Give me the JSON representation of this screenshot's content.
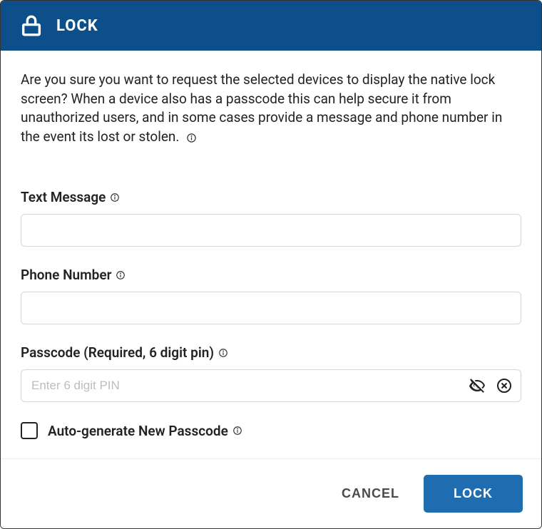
{
  "header": {
    "title": "LOCK"
  },
  "description": "Are you sure you want to request the selected devices to display the native lock screen? When a device also has a passcode this can help secure it from unauthorized users, and in some cases provide a message and phone number in the event its lost or stolen.",
  "fields": {
    "text_message": {
      "label": "Text Message",
      "value": ""
    },
    "phone_number": {
      "label": "Phone Number",
      "value": ""
    },
    "passcode": {
      "label": "Passcode (Required, 6 digit pin)",
      "placeholder": "Enter 6 digit PIN",
      "value": ""
    },
    "auto_generate": {
      "label": "Auto-generate New Passcode",
      "checked": false
    }
  },
  "footer": {
    "cancel_label": "CANCEL",
    "confirm_label": "LOCK"
  }
}
